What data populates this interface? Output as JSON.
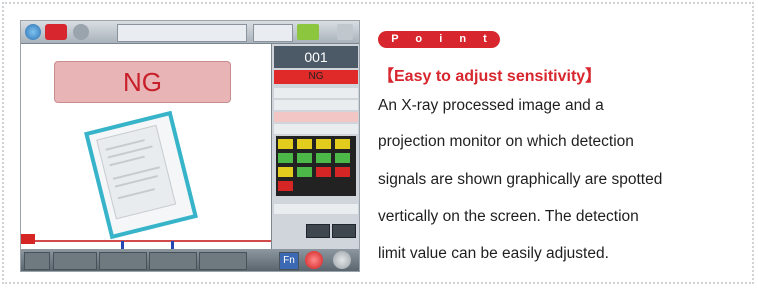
{
  "screenshot": {
    "ng_banner": "NG",
    "panel_counter": "001",
    "panel_status": "NG",
    "fn_key": "Fn"
  },
  "point_label": "P o i n t",
  "heading": "【Easy to adjust sensitivity】",
  "body_lines": [
    "An X-ray processed image and a",
    "projection monitor on which detection",
    "signals are shown graphically are spotted",
    "vertically on the screen.  The detection",
    "limit value can be easily adjusted."
  ],
  "colors": {
    "accent_red": "#d8262e",
    "frame_cyan": "#37b4c9",
    "signal_blue": "#2248b4"
  }
}
